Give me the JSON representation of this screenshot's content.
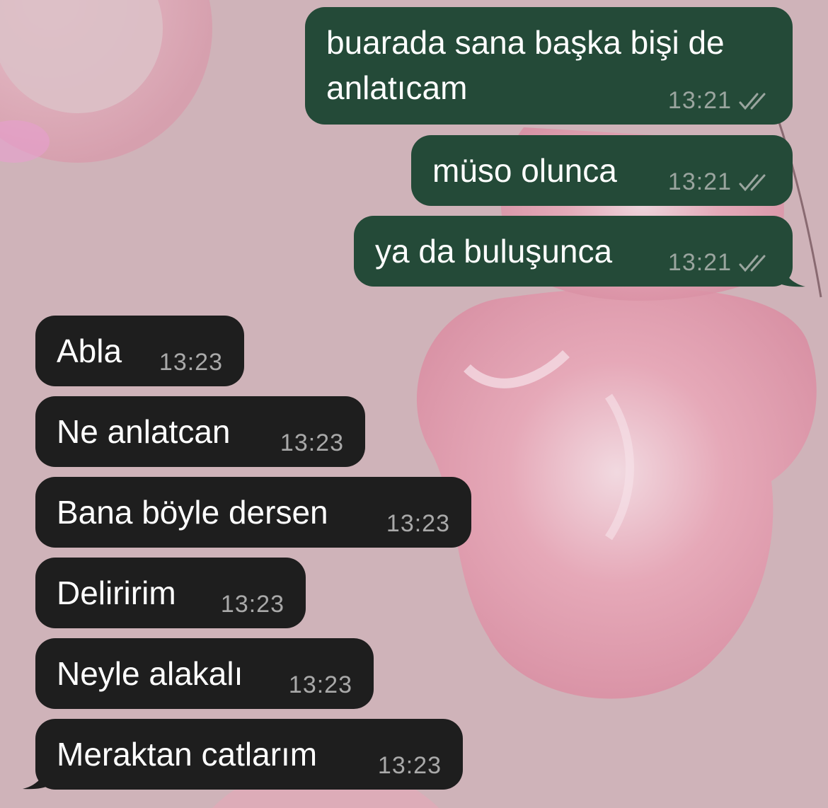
{
  "colors": {
    "outgoing_bubble": "#244a38",
    "incoming_bubble": "#1e1e1e",
    "wallpaper": "#cfb3b9",
    "message_text": "#ffffff",
    "time_text": "#9aa59f"
  },
  "wallpaper": {
    "motif": "pink butterfly"
  },
  "messages": [
    {
      "direction": "outgoing",
      "text": "buarada sana başka bişi de\nanlatıcam",
      "time": "13:21",
      "status_icon": "double-check-icon"
    },
    {
      "direction": "outgoing",
      "text": "müso olunca",
      "time": "13:21",
      "status_icon": "double-check-icon"
    },
    {
      "direction": "outgoing",
      "text": "ya da buluşunca",
      "time": "13:21",
      "status_icon": "double-check-icon"
    },
    {
      "direction": "incoming",
      "text": "Abla",
      "time": "13:23"
    },
    {
      "direction": "incoming",
      "text": "Ne anlatcan",
      "time": "13:23"
    },
    {
      "direction": "incoming",
      "text": "Bana böyle dersen",
      "time": "13:23"
    },
    {
      "direction": "incoming",
      "text": "Deliririm",
      "time": "13:23"
    },
    {
      "direction": "incoming",
      "text": "Neyle alakalı",
      "time": "13:23"
    },
    {
      "direction": "incoming",
      "text": "Meraktan catlarım",
      "time": "13:23"
    }
  ]
}
